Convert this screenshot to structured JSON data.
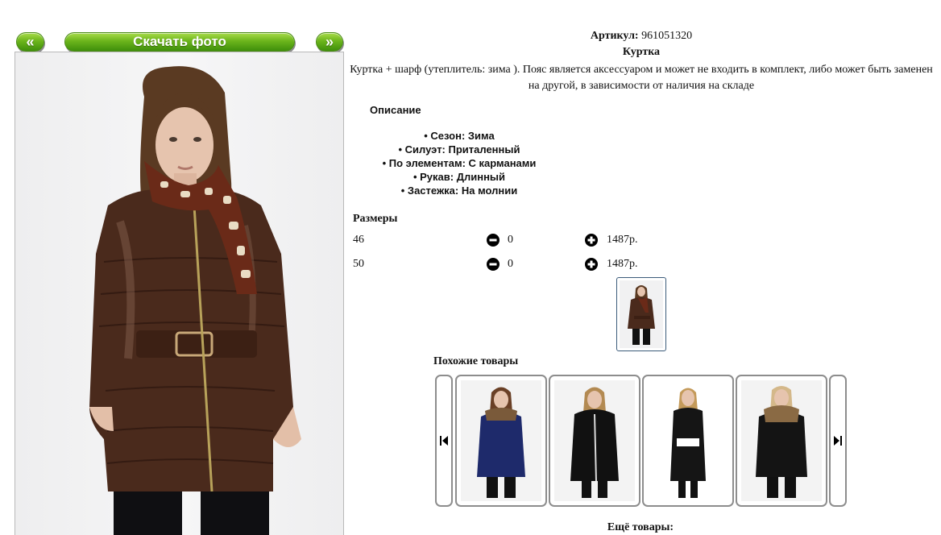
{
  "gallery": {
    "prev_label": "«",
    "download_label": "Скачать фото",
    "next_label": "»"
  },
  "product": {
    "article_label": "Артикул:",
    "article_value": "961051320",
    "title": "Куртка",
    "description": "Куртка + шарф (утеплитель: зима ). Пояс является аксессуаром и может не входить в комплект, либо может быть заменен на другой, в зависимости от наличия на складе"
  },
  "details": {
    "header": "Описание",
    "features": [
      "Сезон: Зима",
      "Силуэт: Приталенный",
      "По элементам: С карманами",
      "Рукав: Длинный",
      "Застежка: На молнии"
    ]
  },
  "sizes": {
    "header": "Размеры",
    "rows": [
      {
        "size": "46",
        "qty": "0",
        "price": "1487р."
      },
      {
        "size": "50",
        "qty": "0",
        "price": "1487р."
      }
    ]
  },
  "similar": {
    "header": "Похожие товары",
    "items": [
      {
        "jacket_color": "#1e2a6b",
        "accent": "#7a5a3a"
      },
      {
        "jacket_color": "#111111",
        "accent": "#d9d9d9"
      },
      {
        "jacket_color": "#151515",
        "accent": "#ffffff"
      },
      {
        "jacket_color": "#141414",
        "accent": "#8a6a44"
      }
    ]
  },
  "more": {
    "header": "Ещё товары:"
  },
  "colors": {
    "button_green": "#6cb51c",
    "jacket_brown": "#4a2a1c",
    "scarf_brown": "#6a2a18",
    "scarf_cream": "#e9dcc4"
  }
}
